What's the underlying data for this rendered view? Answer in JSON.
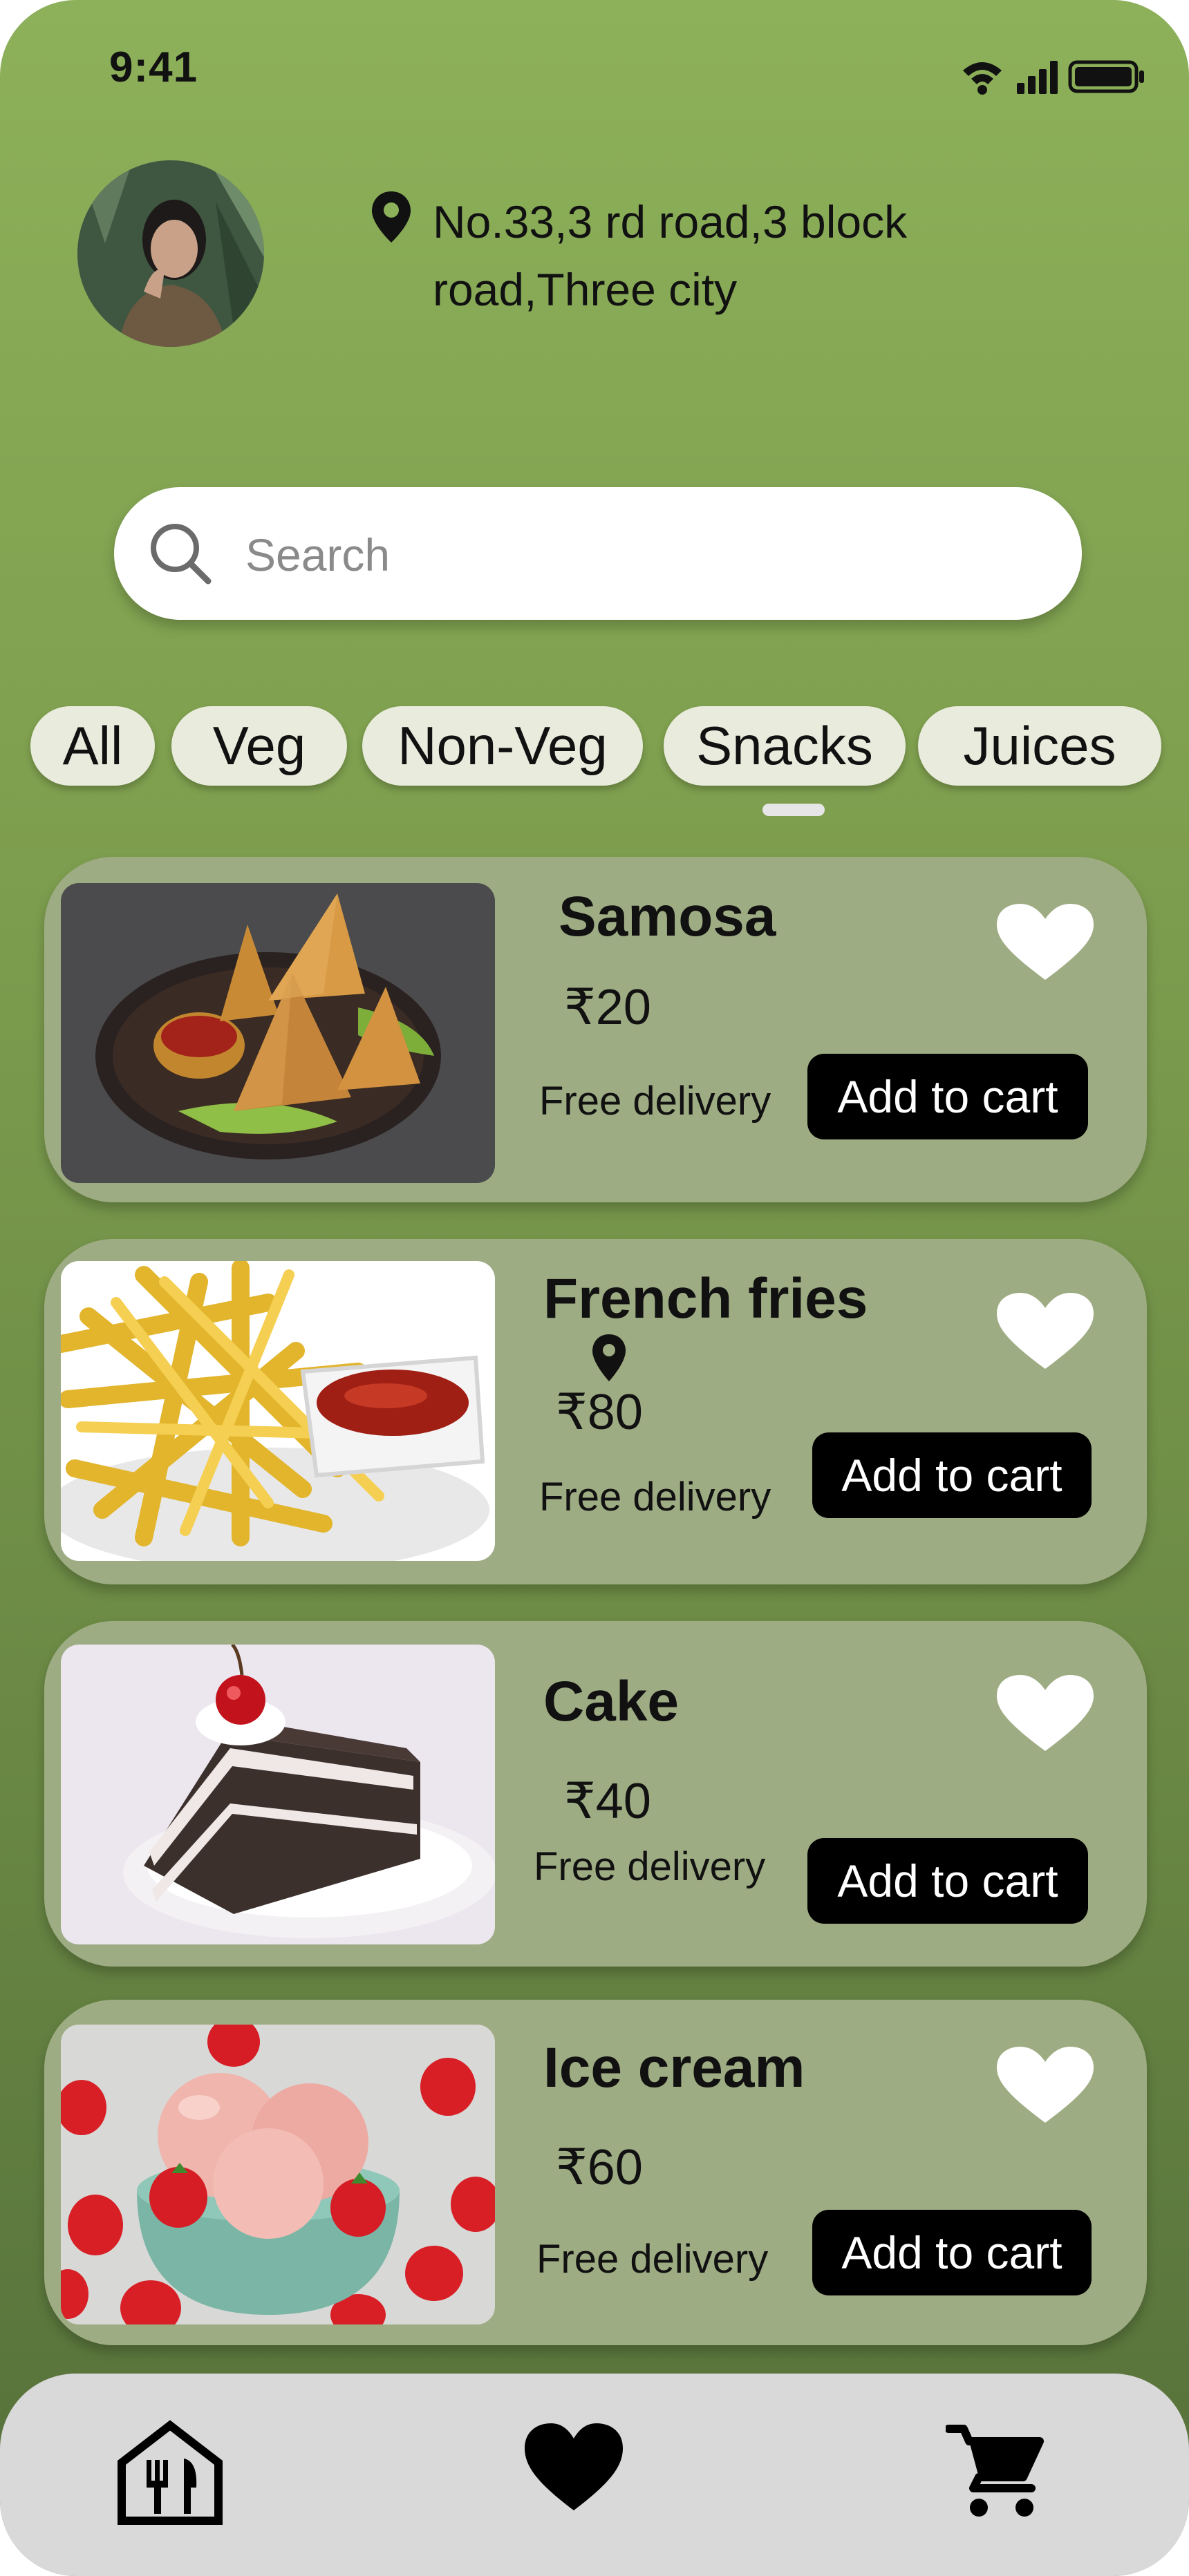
{
  "status_bar": {
    "time": "9:41"
  },
  "header": {
    "address_line1": "No.33,3 rd road,3 block",
    "address_line2": "road,Three city"
  },
  "search": {
    "placeholder": "Search"
  },
  "categories": [
    "All",
    "Veg",
    "Non-Veg",
    "Snacks",
    "Juices"
  ],
  "selected_category": "Snacks",
  "items": [
    {
      "name": "Samosa",
      "price": "₹20",
      "delivery": "Free delivery",
      "cta": "Add to cart"
    },
    {
      "name": "French fries",
      "price": "₹80",
      "delivery": "Free delivery",
      "cta": "Add to cart"
    },
    {
      "name": "Cake",
      "price": "₹40",
      "delivery": "Free delivery",
      "cta": "Add to cart"
    },
    {
      "name": "Ice cream",
      "price": "₹60",
      "delivery": "Free delivery",
      "cta": "Add to cart"
    }
  ],
  "bottom_nav": [
    "restaurant-home-icon",
    "heart-icon",
    "cart-icon"
  ],
  "colors": {
    "background": "#7fa04f",
    "card": "#9eac83",
    "button": "#000000",
    "chip": "#e9ebdd"
  }
}
